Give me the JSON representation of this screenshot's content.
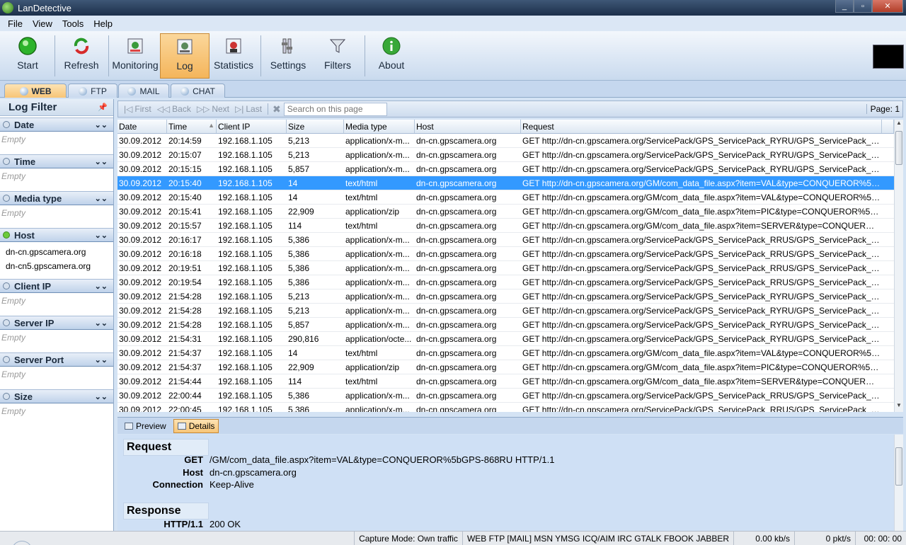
{
  "window": {
    "title": "LanDetective",
    "buttons": [
      "_",
      "▫",
      "✕"
    ]
  },
  "menu": [
    {
      "label": "File"
    },
    {
      "label": "View"
    },
    {
      "label": "Tools"
    },
    {
      "label": "Help"
    }
  ],
  "toolbar": {
    "start": "Start",
    "refresh": "Refresh",
    "monitoring": "Monitoring",
    "log": "Log",
    "statistics": "Statistics",
    "settings": "Settings",
    "filters": "Filters",
    "about": "About"
  },
  "protocol_tabs": {
    "web": "WEB",
    "ftp": "FTP",
    "mail": "MAIL",
    "chat": "CHAT"
  },
  "log_filter": {
    "title": "Log Filter",
    "filters": [
      {
        "label": "Date",
        "values": [],
        "empty": "Empty"
      },
      {
        "label": "Time",
        "values": [],
        "empty": "Empty"
      },
      {
        "label": "Media type",
        "values": [],
        "empty": "Empty"
      },
      {
        "label": "Host",
        "values": [
          "dn-cn.gpscamera.org",
          "dn-cn5.gpscamera.org"
        ],
        "empty": ""
      },
      {
        "label": "Client IP",
        "values": [],
        "empty": "Empty"
      },
      {
        "label": "Server IP",
        "values": [],
        "empty": "Empty"
      },
      {
        "label": "Server Port",
        "values": [],
        "empty": "Empty"
      },
      {
        "label": "Size",
        "values": [],
        "empty": "Empty"
      }
    ]
  },
  "pager": {
    "first": "First",
    "back": "Back",
    "next": "Next",
    "last": "Last",
    "search_placeholder": "Search on this page",
    "page": "Page: 1"
  },
  "grid": {
    "headers": [
      "Date",
      "Time",
      "Client IP",
      "Size",
      "Media type",
      "Host",
      "Request"
    ],
    "selected_row": 4,
    "rows": [
      [
        "30.09.2012",
        "20:14:59",
        "192.168.1.105",
        "5,213",
        "application/x-m...",
        "dn-cn.gpscamera.org",
        "GET http://dn-cn.gpscamera.org/ServicePack/GPS_ServicePack_RYRU/GPS_ServicePack_RYRU..."
      ],
      [
        "30.09.2012",
        "20:15:07",
        "192.168.1.105",
        "5,213",
        "application/x-m...",
        "dn-cn.gpscamera.org",
        "GET http://dn-cn.gpscamera.org/ServicePack/GPS_ServicePack_RYRU/GPS_ServicePack_RYRU..."
      ],
      [
        "30.09.2012",
        "20:15:15",
        "192.168.1.105",
        "5,857",
        "application/x-m...",
        "dn-cn.gpscamera.org",
        "GET http://dn-cn.gpscamera.org/ServicePack/GPS_ServicePack_RYRU/GPS_ServicePack_RYRU..."
      ],
      [
        "30.09.2012",
        "20:15:40",
        "192.168.1.105",
        "14",
        "text/html",
        "dn-cn.gpscamera.org",
        "GET http://dn-cn.gpscamera.org/GM/com_data_file.aspx?item=VAL&type=CONQUEROR%5b..."
      ],
      [
        "30.09.2012",
        "20:15:40",
        "192.168.1.105",
        "14",
        "text/html",
        "dn-cn.gpscamera.org",
        "GET http://dn-cn.gpscamera.org/GM/com_data_file.aspx?item=VAL&type=CONQUEROR%5b..."
      ],
      [
        "30.09.2012",
        "20:15:41",
        "192.168.1.105",
        "22,909",
        "application/zip",
        "dn-cn.gpscamera.org",
        "GET http://dn-cn.gpscamera.org/GM/com_data_file.aspx?item=PIC&type=CONQUEROR%5b..."
      ],
      [
        "30.09.2012",
        "20:15:57",
        "192.168.1.105",
        "114",
        "text/html",
        "dn-cn.gpscamera.org",
        "GET http://dn-cn.gpscamera.org/GM/com_data_file.aspx?item=SERVER&type=CONQUEROR..."
      ],
      [
        "30.09.2012",
        "20:16:17",
        "192.168.1.105",
        "5,386",
        "application/x-m...",
        "dn-cn.gpscamera.org",
        "GET http://dn-cn.gpscamera.org/ServicePack/GPS_ServicePack_RRUS/GPS_ServicePack_RRUS..."
      ],
      [
        "30.09.2012",
        "20:16:18",
        "192.168.1.105",
        "5,386",
        "application/x-m...",
        "dn-cn.gpscamera.org",
        "GET http://dn-cn.gpscamera.org/ServicePack/GPS_ServicePack_RRUS/GPS_ServicePack_RRUS..."
      ],
      [
        "30.09.2012",
        "20:19:51",
        "192.168.1.105",
        "5,386",
        "application/x-m...",
        "dn-cn.gpscamera.org",
        "GET http://dn-cn.gpscamera.org/ServicePack/GPS_ServicePack_RRUS/GPS_ServicePack_RRUS..."
      ],
      [
        "30.09.2012",
        "20:19:54",
        "192.168.1.105",
        "5,386",
        "application/x-m...",
        "dn-cn.gpscamera.org",
        "GET http://dn-cn.gpscamera.org/ServicePack/GPS_ServicePack_RRUS/GPS_ServicePack_RRUS..."
      ],
      [
        "30.09.2012",
        "21:54:28",
        "192.168.1.105",
        "5,213",
        "application/x-m...",
        "dn-cn.gpscamera.org",
        "GET http://dn-cn.gpscamera.org/ServicePack/GPS_ServicePack_RYRU/GPS_ServicePack_RYRU..."
      ],
      [
        "30.09.2012",
        "21:54:28",
        "192.168.1.105",
        "5,213",
        "application/x-m...",
        "dn-cn.gpscamera.org",
        "GET http://dn-cn.gpscamera.org/ServicePack/GPS_ServicePack_RYRU/GPS_ServicePack_RYRU..."
      ],
      [
        "30.09.2012",
        "21:54:28",
        "192.168.1.105",
        "5,857",
        "application/x-m...",
        "dn-cn.gpscamera.org",
        "GET http://dn-cn.gpscamera.org/ServicePack/GPS_ServicePack_RYRU/GPS_ServicePack_RYRU..."
      ],
      [
        "30.09.2012",
        "21:54:31",
        "192.168.1.105",
        "290,816",
        "application/octe...",
        "dn-cn.gpscamera.org",
        "GET http://dn-cn.gpscamera.org/ServicePack/GPS_ServicePack_RYRU/GPS_ServicePack_RYRU..."
      ],
      [
        "30.09.2012",
        "21:54:37",
        "192.168.1.105",
        "14",
        "text/html",
        "dn-cn.gpscamera.org",
        "GET http://dn-cn.gpscamera.org/GM/com_data_file.aspx?item=VAL&type=CONQUEROR%5b..."
      ],
      [
        "30.09.2012",
        "21:54:37",
        "192.168.1.105",
        "22,909",
        "application/zip",
        "dn-cn.gpscamera.org",
        "GET http://dn-cn.gpscamera.org/GM/com_data_file.aspx?item=PIC&type=CONQUEROR%5b..."
      ],
      [
        "30.09.2012",
        "21:54:44",
        "192.168.1.105",
        "114",
        "text/html",
        "dn-cn.gpscamera.org",
        "GET http://dn-cn.gpscamera.org/GM/com_data_file.aspx?item=SERVER&type=CONQUEROR..."
      ],
      [
        "30.09.2012",
        "22:00:44",
        "192.168.1.105",
        "5,386",
        "application/x-m...",
        "dn-cn.gpscamera.org",
        "GET http://dn-cn.gpscamera.org/ServicePack/GPS_ServicePack_RRUS/GPS_ServicePack_RRUS..."
      ],
      [
        "30.09.2012",
        "22:00:45",
        "192.168.1.105",
        "5,386",
        "application/x-m...",
        "dn-cn.gpscamera.org",
        "GET http://dn-cn.gpscamera.org/ServicePack/GPS_ServicePack_RRUS/GPS_ServicePack_RRUS..."
      ]
    ]
  },
  "detail_tabs": {
    "preview": "Preview",
    "details": "Details"
  },
  "details": {
    "request_title": "Request",
    "request": [
      {
        "label": "GET",
        "value": "/GM/com_data_file.aspx?item=VAL&type=CONQUEROR%5bGPS-868RU HTTP/1.1"
      },
      {
        "label": "Host",
        "value": "dn-cn.gpscamera.org"
      },
      {
        "label": "Connection",
        "value": "Keep-Alive"
      }
    ],
    "response_title": "Response",
    "response": [
      {
        "label": "HTTP/1.1",
        "value": "200 OK"
      }
    ]
  },
  "status": {
    "capture_mode": "Capture Mode: Own traffic",
    "protocols": "WEB FTP [MAIL] MSN YMSG ICQ/AIM IRC GTALK FBOOK JABBER",
    "rate": "0.00 kb/s",
    "packets": "0 pkt/s",
    "time": "00: 00: 00"
  }
}
